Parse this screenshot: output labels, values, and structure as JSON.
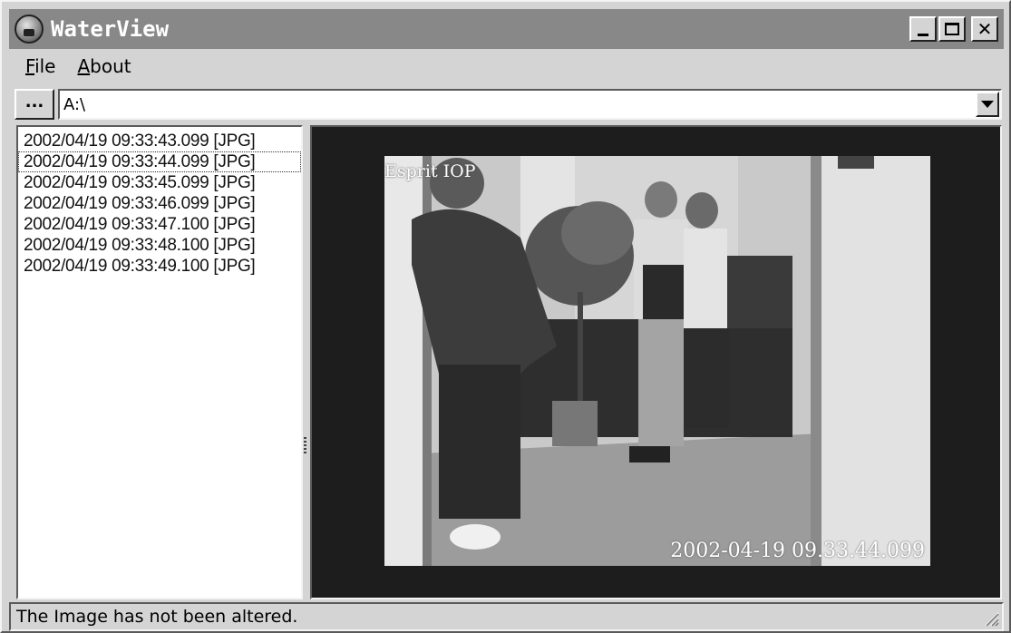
{
  "window": {
    "title": "WaterView",
    "icon": "app-camera-icon"
  },
  "title_buttons": {
    "minimize_icon": "minimize-icon",
    "maximize_icon": "maximize-icon",
    "close_label": "✕"
  },
  "menu": {
    "items": [
      {
        "mnemonic": "F",
        "rest": "ile"
      },
      {
        "mnemonic": "A",
        "rest": "bout"
      }
    ]
  },
  "pathbar": {
    "browse_label": "...",
    "path_value": "A:\\"
  },
  "file_list": {
    "items": [
      "2002/04/19 09:33:43.099 [JPG]",
      "2002/04/19 09:33:44.099 [JPG]",
      "2002/04/19 09:33:45.099 [JPG]",
      "2002/04/19 09:33:46.099 [JPG]",
      "2002/04/19 09:33:47.100 [JPG]",
      "2002/04/19 09:33:48.100 [JPG]",
      "2002/04/19 09:33:49.100 [JPG]"
    ],
    "focused_index": 1
  },
  "image": {
    "overlay_label": "Esprit IOP",
    "overlay_timestamp": "2002-04-19 09.33.44.099"
  },
  "status": {
    "text": "The Image has not been altered."
  },
  "colors": {
    "titlebar": "#888888",
    "chrome": "#d4d4d4",
    "image_background": "#1d1d1d"
  }
}
